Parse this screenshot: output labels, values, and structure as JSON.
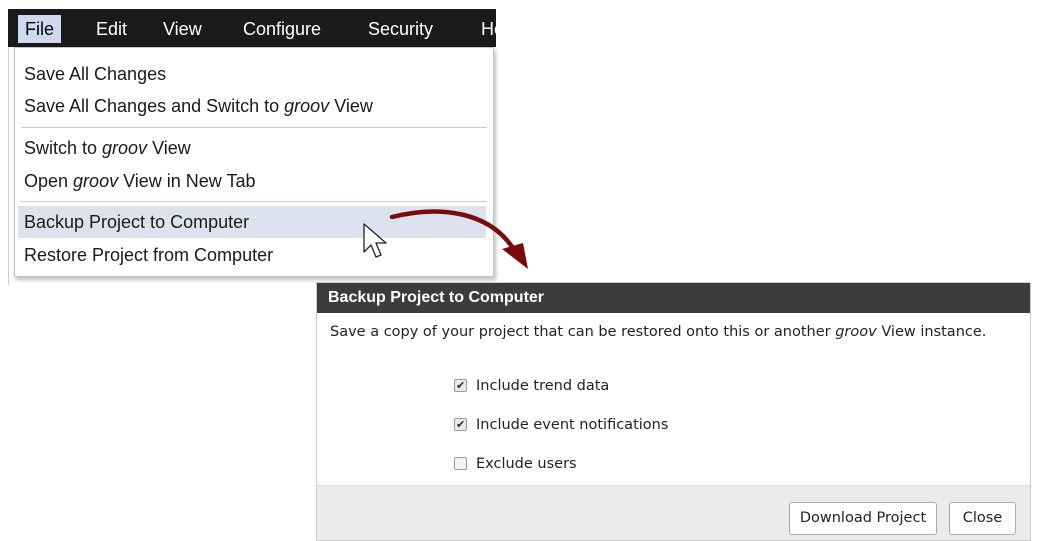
{
  "menubar": {
    "items": [
      {
        "label": "File"
      },
      {
        "label": "Edit"
      },
      {
        "label": "View"
      },
      {
        "label": "Configure"
      },
      {
        "label": "Security"
      },
      {
        "label": "He"
      }
    ]
  },
  "file_menu": {
    "save_all": "Save All Changes",
    "save_switch_prefix": "Save All Changes and Switch to ",
    "groov": "groov",
    "view_suffix": " View",
    "switch_prefix": "Switch to ",
    "open_prefix": "Open ",
    "open_suffix": " View in New Tab",
    "backup": "Backup Project to Computer",
    "restore": "Restore Project from Computer"
  },
  "dialog": {
    "title": "Backup Project to Computer",
    "desc_prefix": "Save a copy of your project that can be restored onto this or another ",
    "desc_groov": "groov",
    "desc_suffix": " View instance.",
    "options": [
      {
        "label": "Include trend data",
        "checked": true
      },
      {
        "label": "Include event notifications",
        "checked": true
      },
      {
        "label": "Exclude users",
        "checked": false
      }
    ],
    "download_label": "Download Project",
    "close_label": "Close"
  },
  "colors": {
    "menubar_bg": "#1a1a1a",
    "menu_active": "#cfd9ec",
    "dialog_title_bg": "#3c3c3c",
    "arrow": "#7a0a0a"
  }
}
